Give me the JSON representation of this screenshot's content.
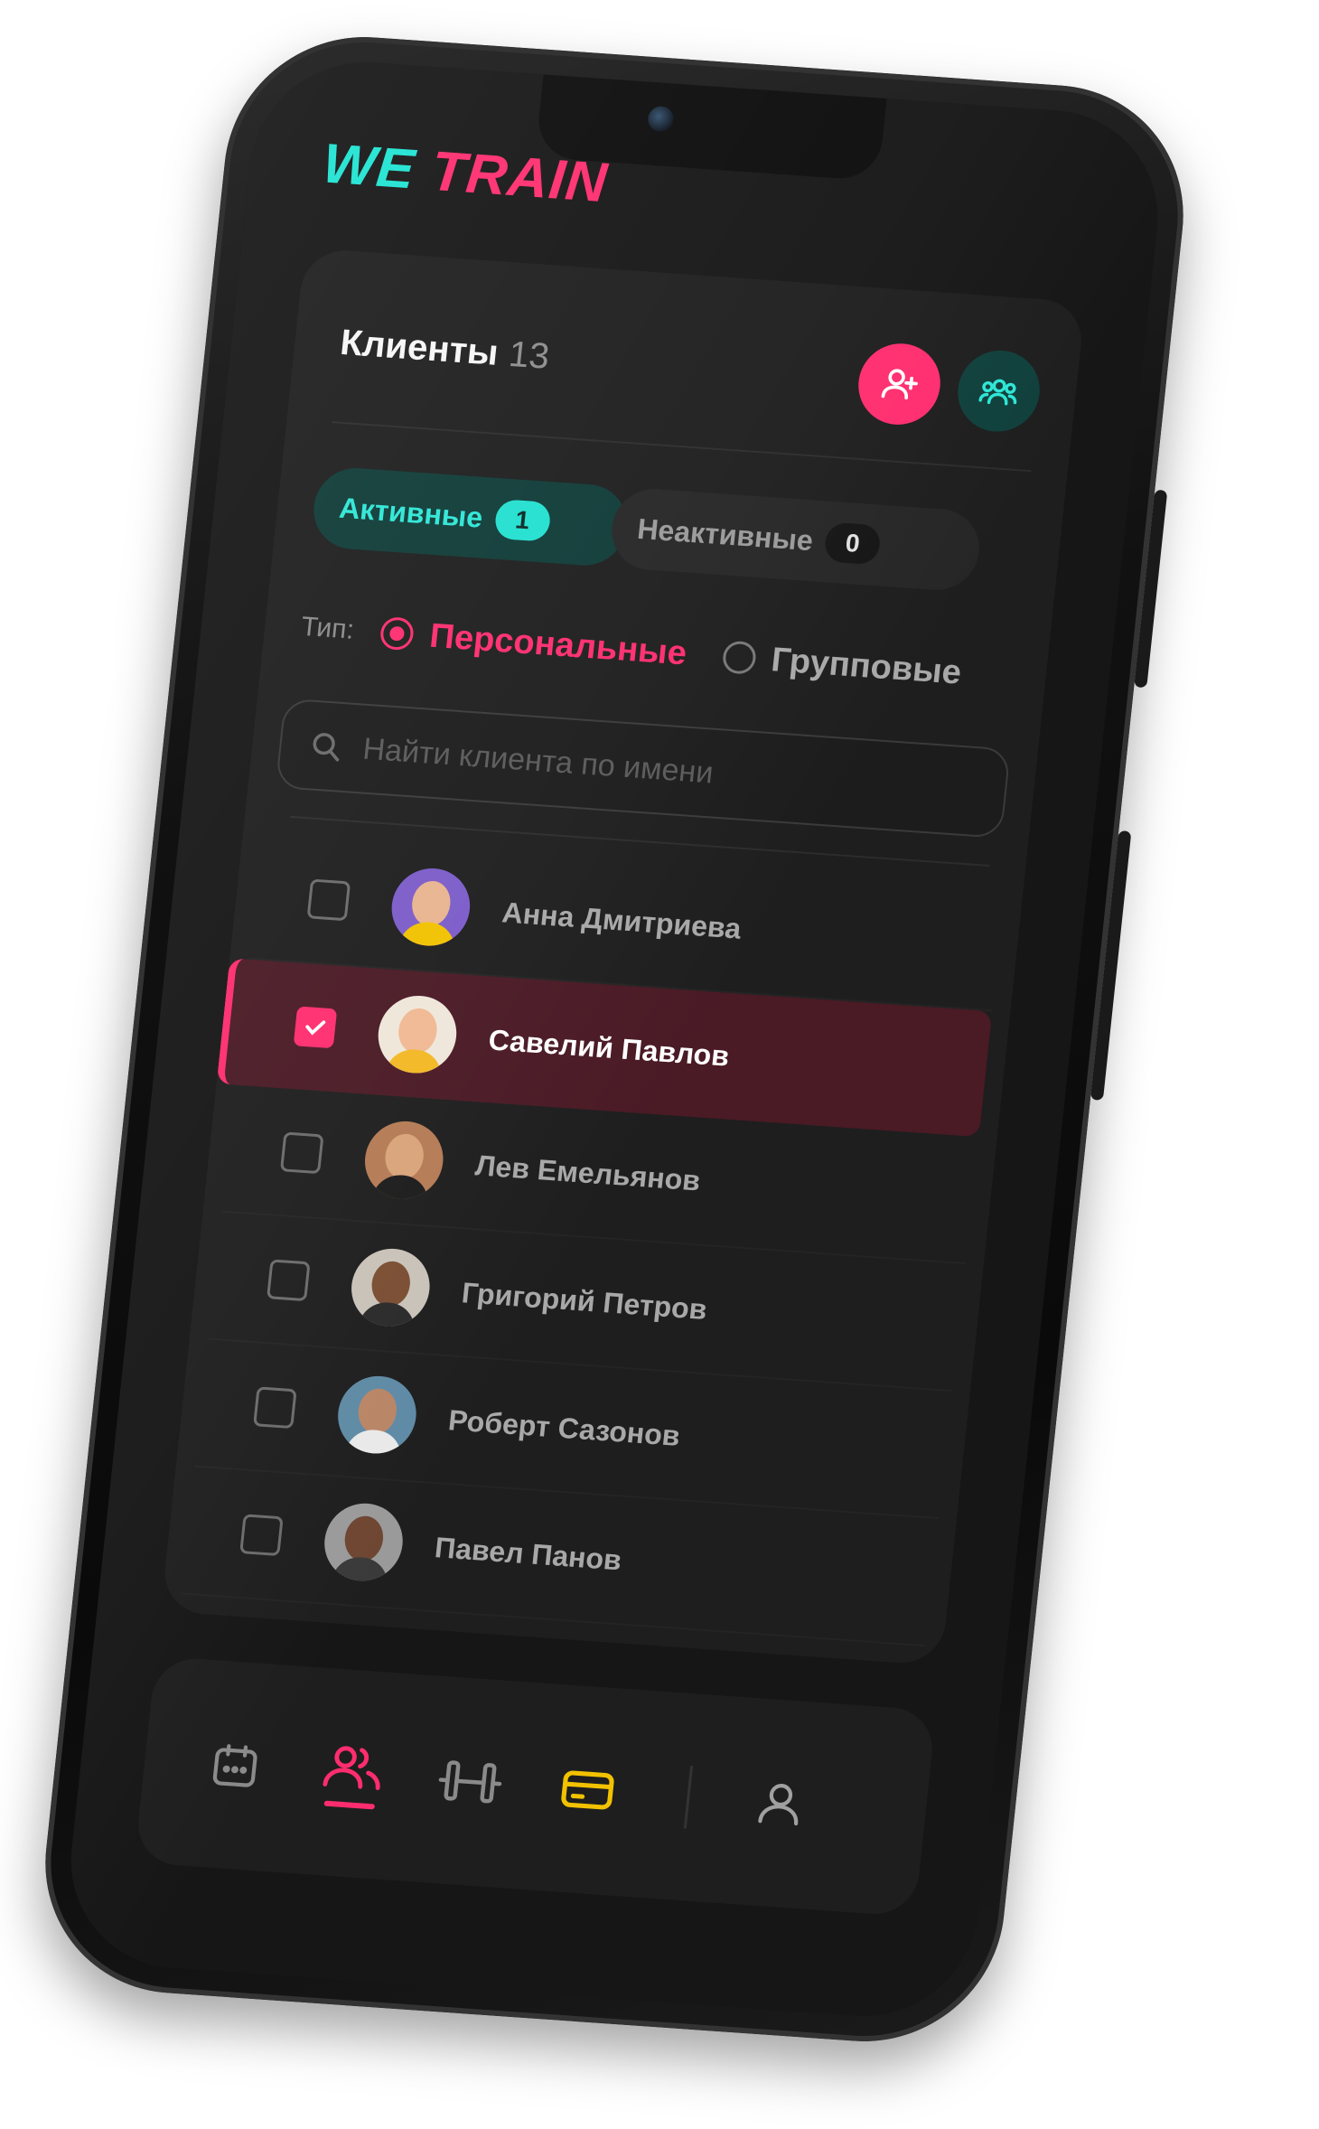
{
  "app": {
    "logo_we": "WE",
    "logo_train": "TRAIN"
  },
  "header": {
    "title": "Клиенты",
    "count": "13"
  },
  "tabs": {
    "active_label": "Активные",
    "active_count": "1",
    "inactive_label": "Неактивные",
    "inactive_count": "0"
  },
  "type_filter": {
    "label": "Тип:",
    "option_personal": "Персональные",
    "option_group": "Групповые",
    "selected": "Персональные"
  },
  "search": {
    "placeholder": "Найти клиента по имени",
    "value": ""
  },
  "clients": [
    {
      "name": "Анна Дмитриева",
      "selected": false
    },
    {
      "name": "Савелий Павлов",
      "selected": true
    },
    {
      "name": "Лев Емельянов",
      "selected": false
    },
    {
      "name": "Григорий Петров",
      "selected": false
    },
    {
      "name": "Роберт Сазонов",
      "selected": false
    },
    {
      "name": "Павел Панов",
      "selected": false
    }
  ],
  "bottom_nav": {
    "items": [
      "calendar-icon",
      "clients-icon",
      "dumbbell-icon",
      "card-icon",
      "profile-icon"
    ],
    "active": "clients-icon"
  },
  "colors": {
    "accent_pink": "#ff2d6f",
    "accent_teal": "#1fe3d2",
    "accent_yellow": "#f2c200",
    "background": "#161616"
  }
}
